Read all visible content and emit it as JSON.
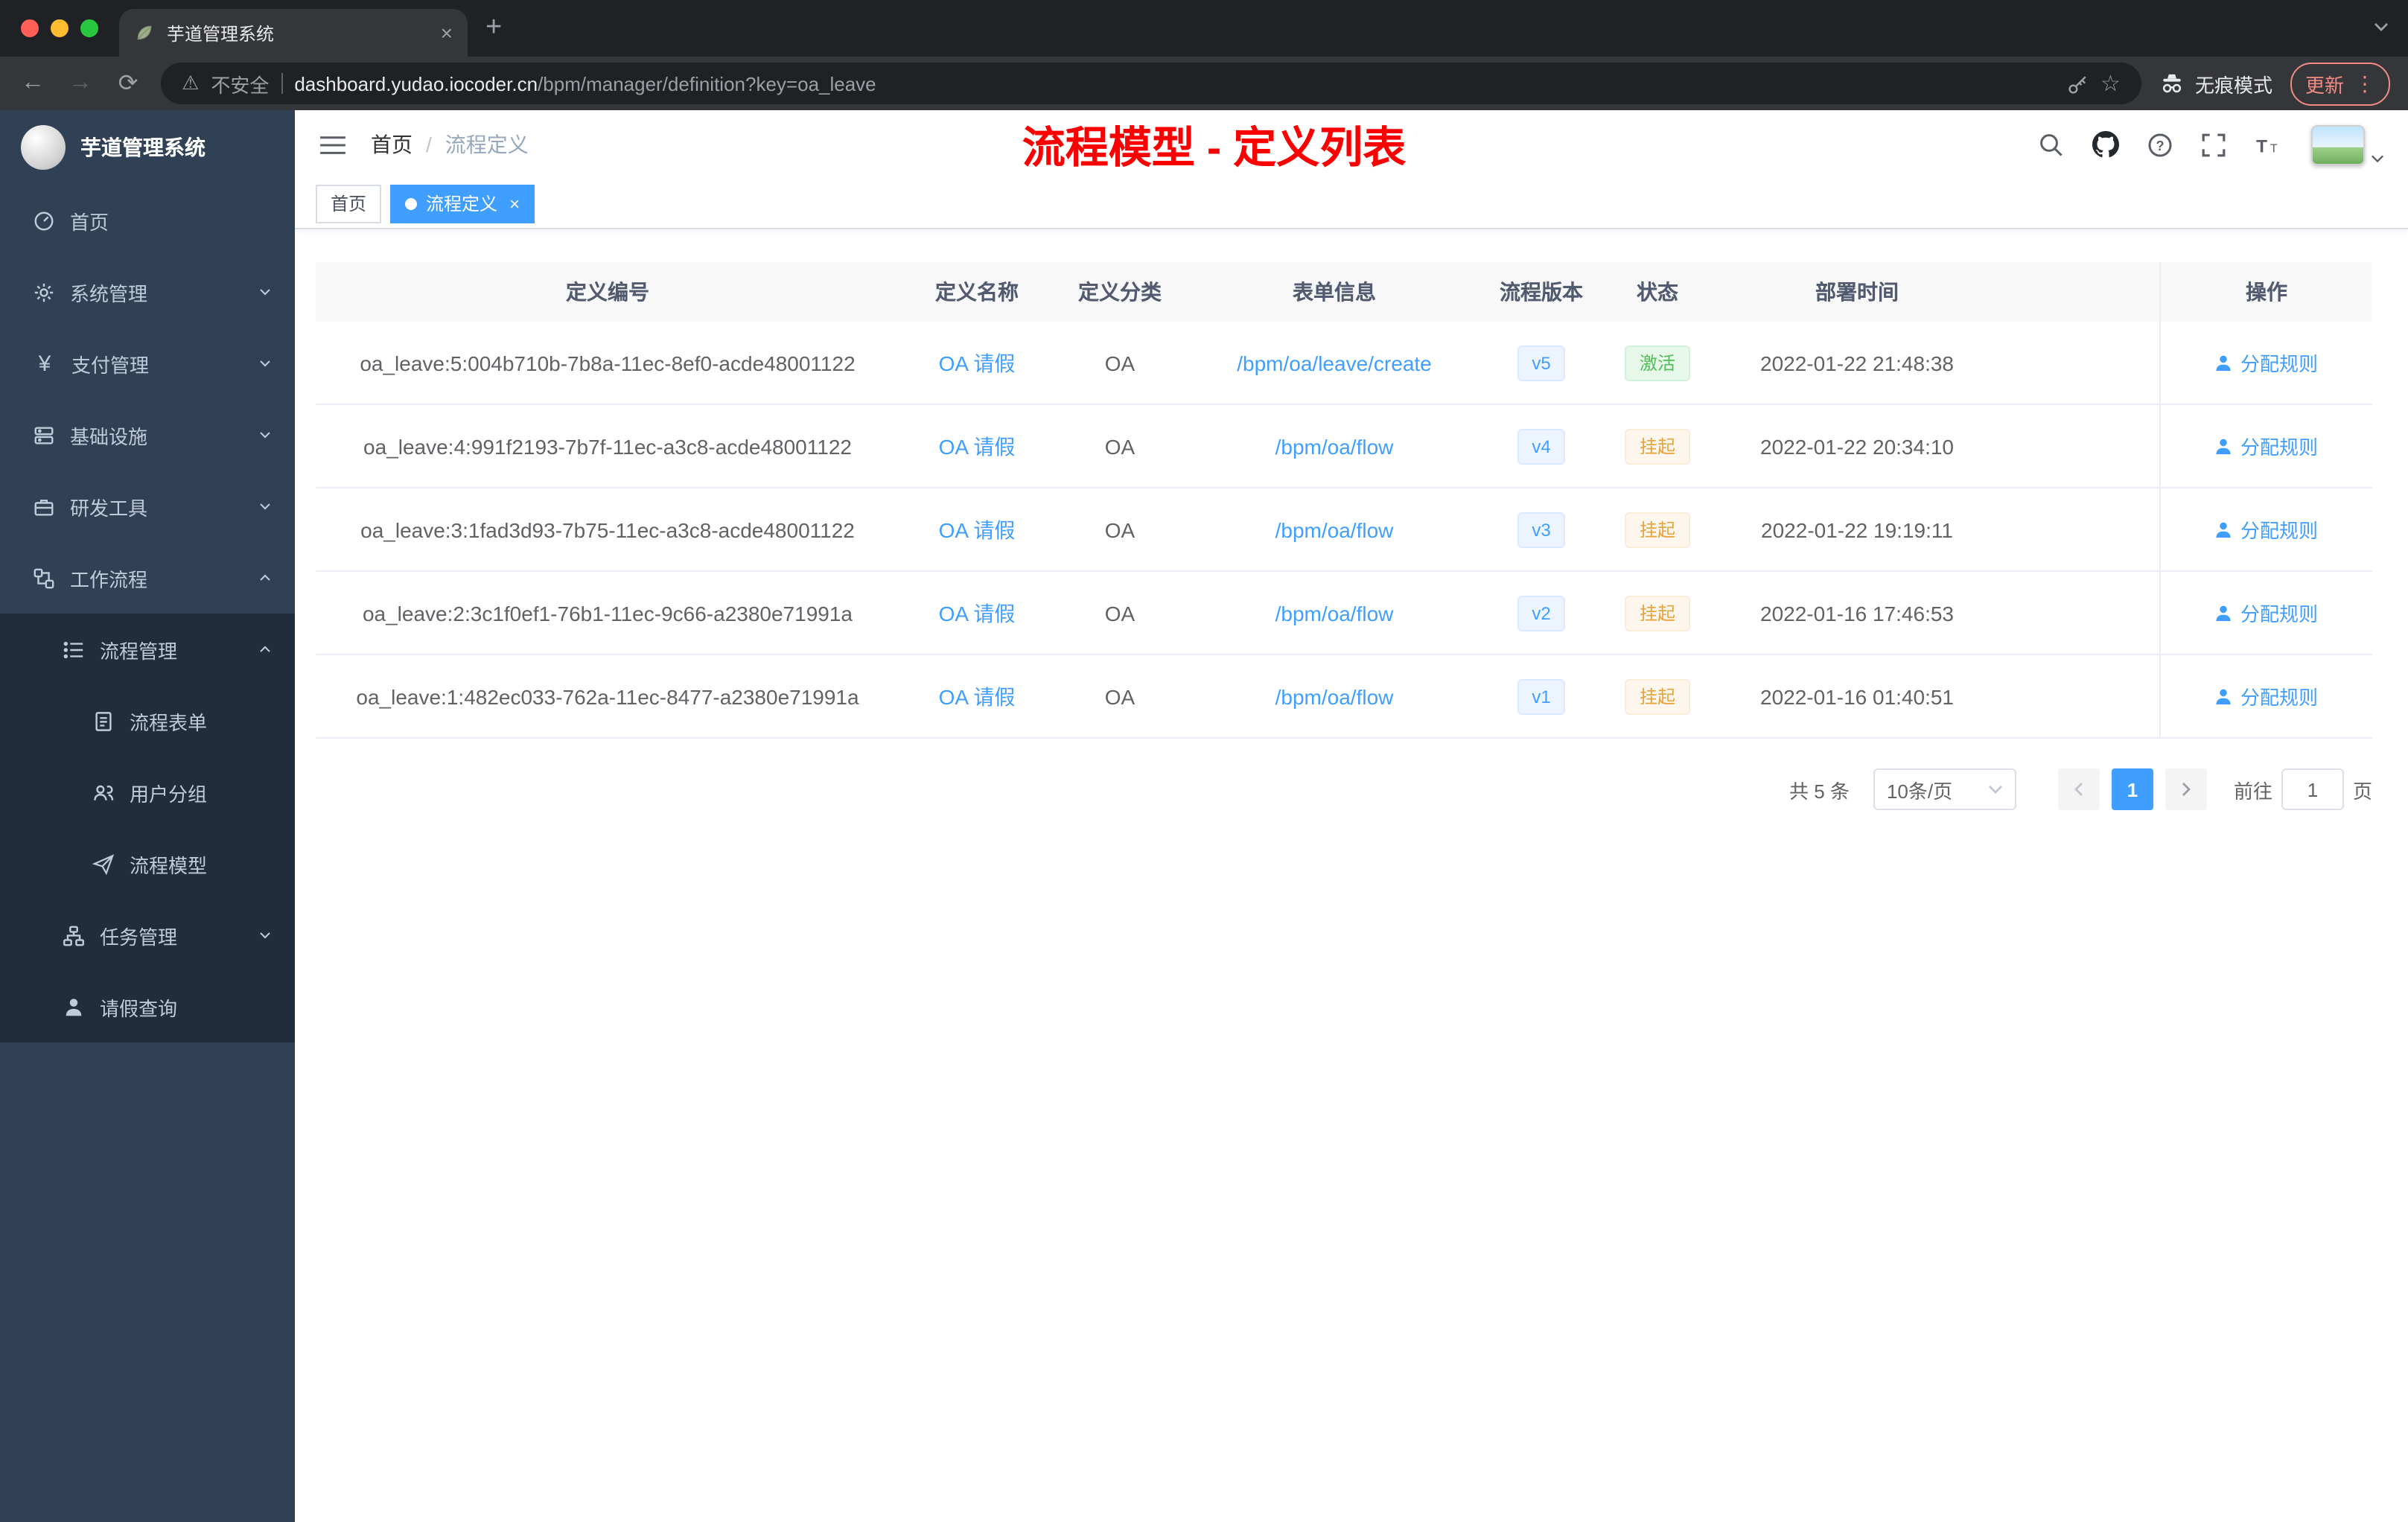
{
  "colors": {
    "accent": "#409eff",
    "annotation_red": "#fb0000",
    "sidebar_bg": "#304156",
    "submenu_bg": "#1f2d3d",
    "status_active_green": "#4fbe58",
    "status_suspend_orange": "#e6a23c"
  },
  "browser": {
    "tab": {
      "title": "芋道管理系统"
    },
    "address": {
      "security_label": "不安全",
      "domain": "dashboard.yudao.iocoder.cn",
      "path": "/bpm/manager/definition?key=oa_leave"
    },
    "incognito_label": "无痕模式",
    "update_label": "更新"
  },
  "sidebar": {
    "logo_title": "芋道管理系统",
    "items": [
      {
        "label": "首页"
      },
      {
        "label": "系统管理"
      },
      {
        "label": "支付管理"
      },
      {
        "label": "基础设施"
      },
      {
        "label": "研发工具"
      },
      {
        "label": "工作流程"
      },
      {
        "label": "流程管理"
      },
      {
        "label": "流程表单"
      },
      {
        "label": "用户分组"
      },
      {
        "label": "流程模型"
      },
      {
        "label": "任务管理"
      },
      {
        "label": "请假查询"
      }
    ]
  },
  "header": {
    "breadcrumb": {
      "home": "首页",
      "current": "流程定义"
    },
    "annotation": "流程模型 - 定义列表"
  },
  "tags": {
    "home": "首页",
    "active": "流程定义"
  },
  "table": {
    "columns": {
      "id": "定义编号",
      "name": "定义名称",
      "category": "定义分类",
      "form": "表单信息",
      "version": "流程版本",
      "status": "状态",
      "deploy_time": "部署时间",
      "actions": "操作"
    },
    "rows": [
      {
        "id": "oa_leave:5:004b710b-7b8a-11ec-8ef0-acde48001122",
        "name": "OA 请假",
        "category": "OA",
        "form": "/bpm/oa/leave/create",
        "version": "v5",
        "status": "激活",
        "deploy_time": "2022-01-22 21:48:38",
        "action": "分配规则"
      },
      {
        "id": "oa_leave:4:991f2193-7b7f-11ec-a3c8-acde48001122",
        "name": "OA 请假",
        "category": "OA",
        "form": "/bpm/oa/flow",
        "version": "v4",
        "status": "挂起",
        "deploy_time": "2022-01-22 20:34:10",
        "action": "分配规则"
      },
      {
        "id": "oa_leave:3:1fad3d93-7b75-11ec-a3c8-acde48001122",
        "name": "OA 请假",
        "category": "OA",
        "form": "/bpm/oa/flow",
        "version": "v3",
        "status": "挂起",
        "deploy_time": "2022-01-22 19:19:11",
        "action": "分配规则"
      },
      {
        "id": "oa_leave:2:3c1f0ef1-76b1-11ec-9c66-a2380e71991a",
        "name": "OA 请假",
        "category": "OA",
        "form": "/bpm/oa/flow",
        "version": "v2",
        "status": "挂起",
        "deploy_time": "2022-01-16 17:46:53",
        "action": "分配规则"
      },
      {
        "id": "oa_leave:1:482ec033-762a-11ec-8477-a2380e71991a",
        "name": "OA 请假",
        "category": "OA",
        "form": "/bpm/oa/flow",
        "version": "v1",
        "status": "挂起",
        "deploy_time": "2022-01-16 01:40:51",
        "action": "分配规则"
      }
    ]
  },
  "pagination": {
    "total": "共 5 条",
    "page_size": "10条/页",
    "current_page": "1",
    "goto_label": "前往",
    "goto_value": "1",
    "page_unit": "页"
  }
}
